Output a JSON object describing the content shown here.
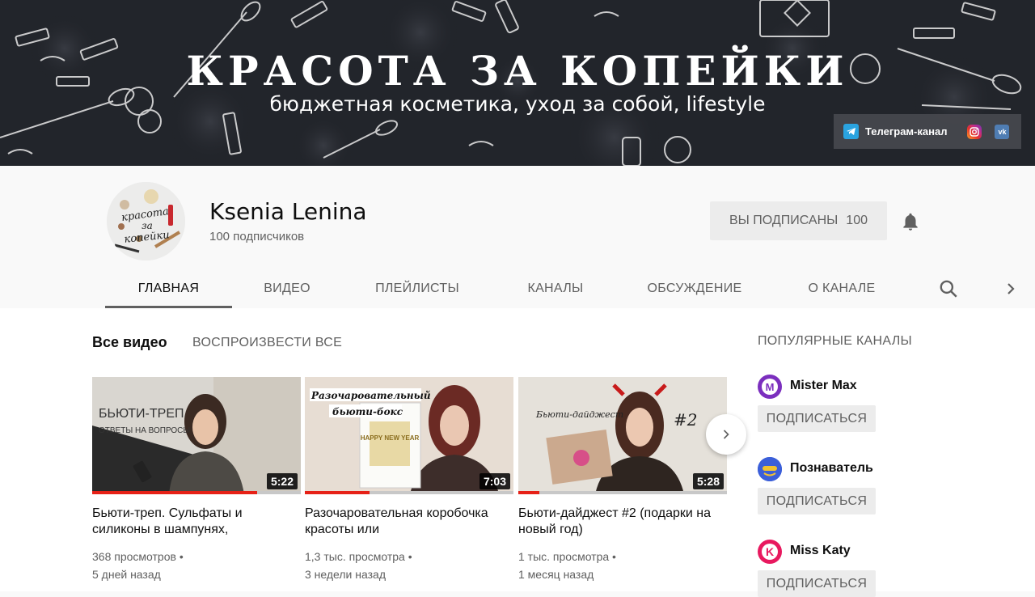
{
  "banner": {
    "title": "КРАСОТА ЗА КОПЕЙКИ",
    "subtitle": "бюджетная косметика, уход за собой, lifestyle",
    "links": [
      {
        "label": "Телеграм-канал",
        "icon": "telegram-icon"
      },
      {
        "label": "",
        "icon": "instagram-icon"
      },
      {
        "label": "",
        "icon": "vk-icon"
      }
    ]
  },
  "channel": {
    "name": "Ksenia Lenina",
    "subscribers": "100 подписчиков",
    "avatar_text": "красота за копейки",
    "subscribed_label": "ВЫ ПОДПИСАНЫ",
    "subscribed_count": "100"
  },
  "tabs": [
    {
      "label": "ГЛАВНАЯ",
      "active": true
    },
    {
      "label": "ВИДЕО",
      "active": false
    },
    {
      "label": "ПЛЕЙЛИСТЫ",
      "active": false
    },
    {
      "label": "КАНАЛЫ",
      "active": false
    },
    {
      "label": "ОБСУЖДЕНИЕ",
      "active": false
    },
    {
      "label": "О КАНАЛЕ",
      "active": false
    }
  ],
  "section": {
    "title": "Все видео",
    "play_all": "ВОСПРОИЗВЕСТИ ВСЕ"
  },
  "videos": [
    {
      "title": "Бьюти-треп. Сульфаты и силиконы в шампунях,",
      "duration": "5:22",
      "views": "368 просмотров",
      "age": "5 дней назад",
      "watched_fraction": 0.79,
      "thumb_text_1": "БЬЮТИ-ТРЕП",
      "thumb_text_2": "ОТВЕТЫ НА ВОПРОСЫ"
    },
    {
      "title": "Разочаровательная коробочка красоты или",
      "duration": "7:03",
      "views": "1,3 тыс. просмотра",
      "age": "3 недели назад",
      "watched_fraction": 0.31,
      "thumb_text_1": "Разочаровательный",
      "thumb_text_2": "бьюти-бокс",
      "thumb_text_3": "HAPPY NEW YEAR"
    },
    {
      "title": "Бьюти-дайджест #2 (подарки на новый год)",
      "duration": "5:28",
      "views": "1 тыс. просмотра",
      "age": "1 месяц назад",
      "watched_fraction": 0.1,
      "thumb_text_1": "Бьюти-дайджест",
      "thumb_text_2": "#2"
    }
  ],
  "sidebar": {
    "title": "ПОПУЛЯРНЫЕ КАНАЛЫ",
    "channels": [
      {
        "name": "Mister Max",
        "button": "ПОДПИСАТЬСЯ",
        "color": "#7b2fbe",
        "avatar_letter": "M"
      },
      {
        "name": "Познаватель",
        "button": "ПОДПИСАТЬСЯ",
        "color": "#3b5fd9",
        "avatar_letter": ""
      },
      {
        "name": "Miss Katy",
        "button": "ПОДПИСАТЬСЯ",
        "color": "#e8195f",
        "avatar_letter": "K"
      }
    ]
  },
  "colors": {
    "accent_red": "#e62117",
    "banner_bg": "#1d1f24"
  }
}
